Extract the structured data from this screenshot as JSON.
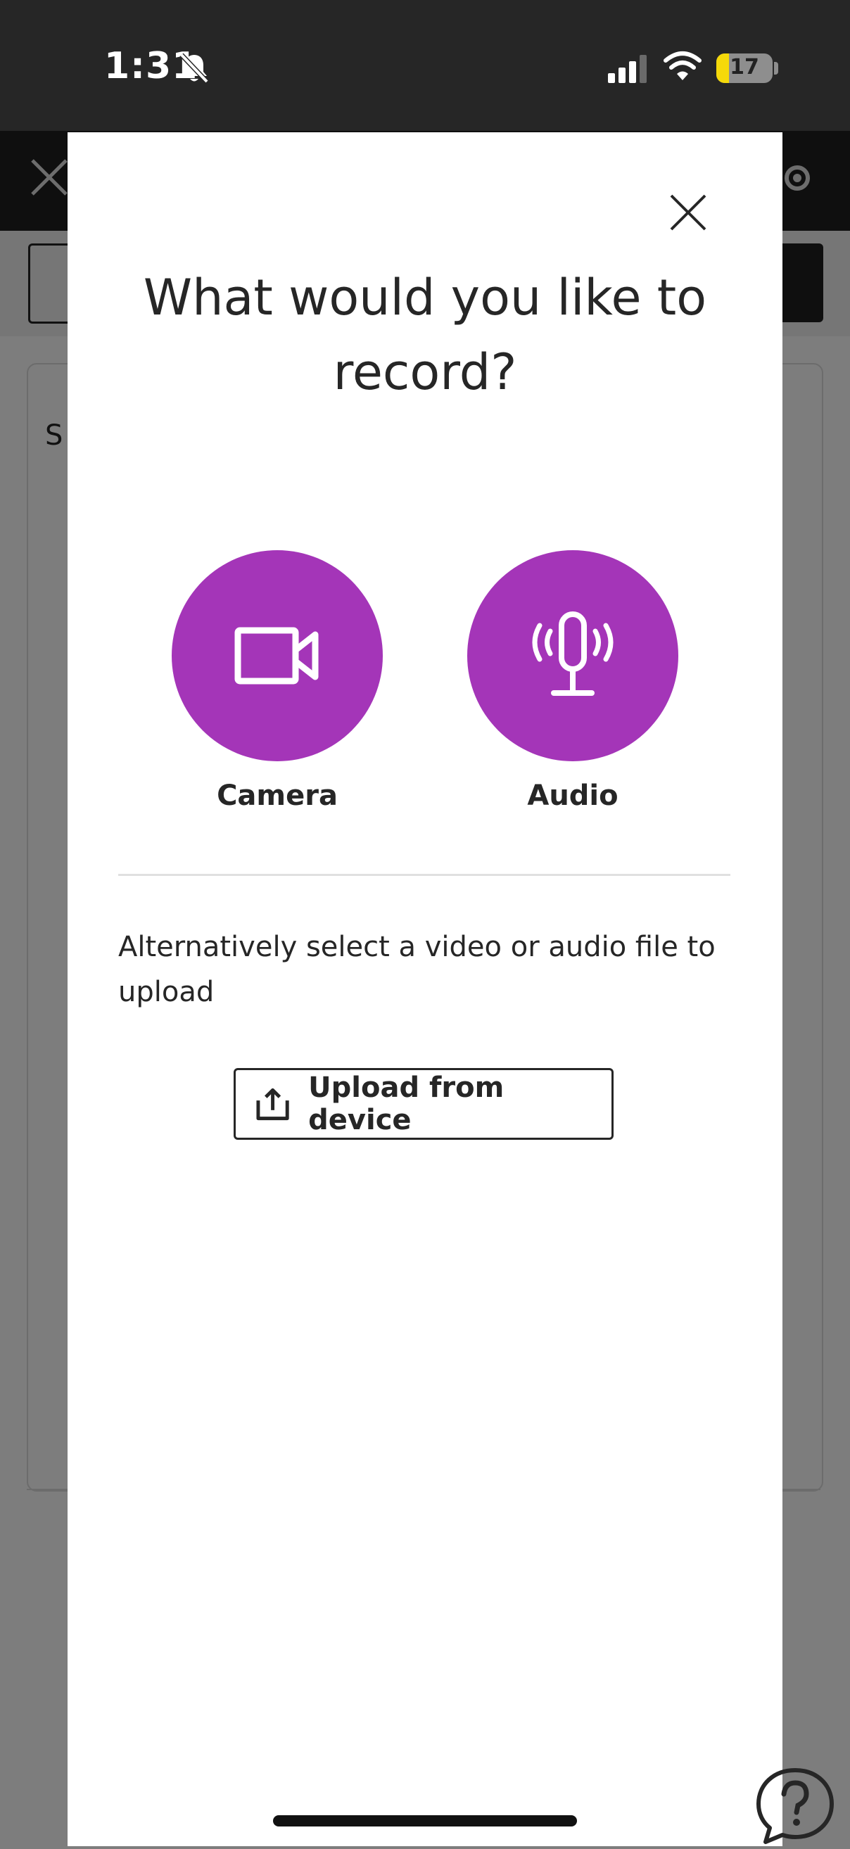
{
  "status_bar": {
    "time": "1:31",
    "battery": "17",
    "icons": [
      "bell-slash-icon",
      "signal-icon",
      "wifi-icon",
      "battery-icon"
    ]
  },
  "background": {
    "label": "S"
  },
  "modal": {
    "title": "What would you like to record?",
    "options": [
      {
        "label": "Camera",
        "icon": "video-camera-icon"
      },
      {
        "label": "Audio",
        "icon": "microphone-icon"
      }
    ],
    "alt_text": "Alternatively select a video or audio file to upload",
    "upload_label": "Upload from device",
    "accent_color": "#a435b8"
  }
}
